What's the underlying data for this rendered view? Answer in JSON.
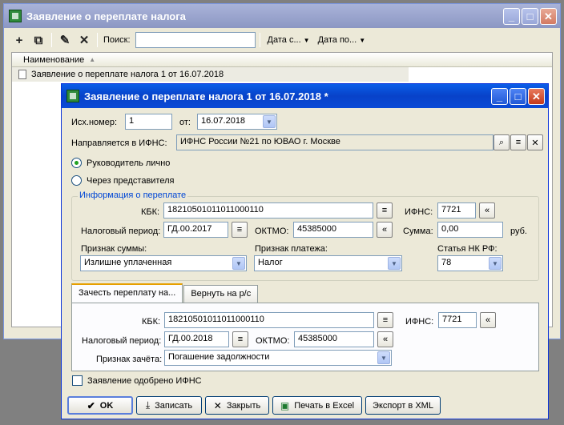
{
  "main_window": {
    "title": "Заявление о переплате налога",
    "toolbar": {
      "search_label": "Поиск:",
      "search_value": "",
      "date_from_label": "Дата с...",
      "date_to_label": "Дата по..."
    },
    "list": {
      "column_header": "Наименование",
      "rows": [
        "Заявление о переплате налога 1 от 16.07.2018"
      ]
    }
  },
  "dialog": {
    "title": "Заявление о переплате налога 1 от 16.07.2018 *",
    "outgoing_number_label": "Исх.номер:",
    "outgoing_number_value": "1",
    "date_label": "от:",
    "date_value": "16.07.2018",
    "ifns_target_label": "Направляется в ИФНС:",
    "ifns_target_value": "ИФНС России №21 по ЮВАО г. Москве",
    "radio_head": "Руководитель лично",
    "radio_rep": "Через представителя",
    "overpay_group_title": "Информация о переплате",
    "kbk_label": "КБК:",
    "kbk_value": "18210501011011000110",
    "ifns_label": "ИФНС:",
    "ifns_value": "7721",
    "period_label": "Налоговый период:",
    "period_value": "ГД.00.2017",
    "oktmo_label": "ОКТМО:",
    "oktmo_value": "45385000",
    "sum_label": "Сумма:",
    "sum_value": "0,00",
    "sum_unit": "руб.",
    "sum_sign_label": "Признак суммы:",
    "sum_sign_value": "Излишне уплаченная",
    "payment_sign_label": "Признак платежа:",
    "payment_sign_value": "Налог",
    "nk_article_label": "Статья НК РФ:",
    "nk_article_value": "78",
    "tabs": [
      "Зачесть переплату на...",
      "Вернуть на р/с"
    ],
    "tab_kbk_label": "КБК:",
    "tab_kbk_value": "18210501011011000110",
    "tab_ifns_label": "ИФНС:",
    "tab_ifns_value": "7721",
    "tab_period_label": "Налоговый период:",
    "tab_period_value": "ГД.00.2018",
    "tab_oktmo_label": "ОКТМО:",
    "tab_oktmo_value": "45385000",
    "offset_sign_label": "Признак зачёта:",
    "offset_sign_value": "Погашение задолжности",
    "approved_label": "Заявление одобрено ИФНС",
    "buttons": {
      "ok": "OK",
      "save": "Записать",
      "close": "Закрыть",
      "excel": "Печать в Excel",
      "xml": "Экспорт в XML"
    }
  }
}
